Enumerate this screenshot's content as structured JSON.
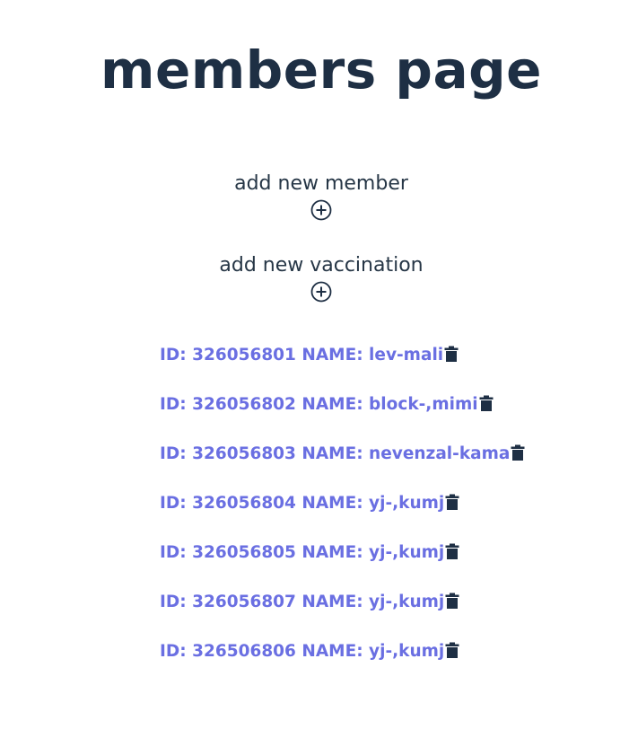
{
  "page": {
    "title": "members page"
  },
  "actions": {
    "add_member_label": "add new member",
    "add_member_icon": "plus-circle-icon",
    "add_vaccination_label": "add new vaccination",
    "add_vaccination_icon": "plus-circle-icon"
  },
  "members": [
    {
      "text": "ID: 326056801 NAME: lev-mali",
      "icon": "trash-icon"
    },
    {
      "text": "ID: 326056802 NAME: block-,mimi",
      "icon": "trash-icon"
    },
    {
      "text": "ID: 326056803 NAME: nevenzal-kama",
      "icon": "trash-icon"
    },
    {
      "text": "ID: 326056804 NAME: yj-,kumj",
      "icon": "trash-icon"
    },
    {
      "text": "ID: 326056805 NAME: yj-,kumj",
      "icon": "trash-icon"
    },
    {
      "text": "ID: 326056807 NAME: yj-,kumj",
      "icon": "trash-icon"
    },
    {
      "text": "ID: 326506806 NAME: yj-,kumj",
      "icon": "trash-icon"
    }
  ],
  "colors": {
    "title": "#1e2f44",
    "label": "#263646",
    "member_link": "#6a6fe2",
    "icon": "#1e2f44"
  }
}
